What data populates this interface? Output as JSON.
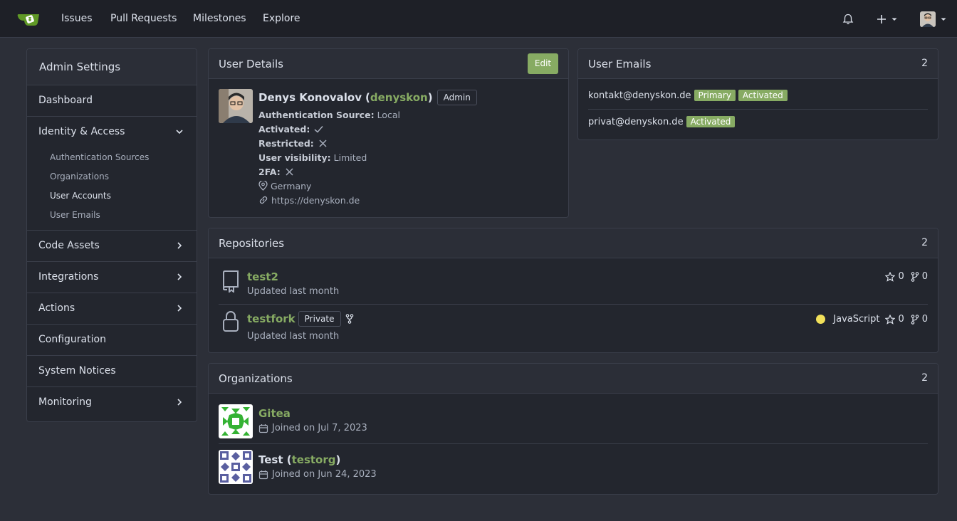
{
  "nav": {
    "links": [
      "Issues",
      "Pull Requests",
      "Milestones",
      "Explore"
    ],
    "icons": [
      "gitea-logo-icon",
      "bell-icon",
      "plus-icon",
      "chevron-down-icon",
      "avatar"
    ]
  },
  "sidebar": {
    "title": "Admin Settings",
    "items": [
      {
        "label": "Dashboard"
      },
      {
        "label": "Identity & Access",
        "expanded": true,
        "children": [
          "Authentication Sources",
          "Organizations",
          "User Accounts",
          "User Emails"
        ],
        "active_child": "User Accounts"
      },
      {
        "label": "Code Assets"
      },
      {
        "label": "Integrations"
      },
      {
        "label": "Actions"
      },
      {
        "label": "Configuration"
      },
      {
        "label": "System Notices"
      },
      {
        "label": "Monitoring"
      }
    ]
  },
  "user_details": {
    "title": "User Details",
    "edit_label": "Edit",
    "full_name": "Denys Konovalov",
    "username": "denyskon",
    "role_badge": "Admin",
    "auth_source_label": "Authentication Source:",
    "auth_source": "Local",
    "activated_label": "Activated:",
    "restricted_label": "Restricted:",
    "visibility_label": "User visibility:",
    "visibility": "Limited",
    "twofa_label": "2FA:",
    "location": "Germany",
    "website": "https://denyskon.de"
  },
  "user_emails": {
    "title": "User Emails",
    "count": "2",
    "emails": [
      {
        "address": "kontakt@denyskon.de",
        "badges": [
          "Primary",
          "Activated"
        ]
      },
      {
        "address": "privat@denyskon.de",
        "badges": [
          "Activated"
        ]
      }
    ]
  },
  "repositories": {
    "title": "Repositories",
    "count": "2",
    "items": [
      {
        "name": "test2",
        "updated": "Updated last month",
        "stars": "0",
        "forks": "0"
      },
      {
        "name": "testfork",
        "badge": "Private",
        "updated": "Updated last month",
        "language": "JavaScript",
        "language_color": "#f1e05a",
        "stars": "0",
        "forks": "0"
      }
    ]
  },
  "organizations": {
    "title": "Organizations",
    "count": "2",
    "items": [
      {
        "name": "Gitea",
        "joined": "Joined on Jul 7, 2023"
      },
      {
        "name_prefix": "Test (",
        "handle": "testorg",
        "name_suffix": ")",
        "joined": "Joined on Jun 24, 2023"
      }
    ]
  },
  "colors": {
    "accent": "#87ab63",
    "bg": "#2c2f38",
    "panel": "#23262e"
  }
}
